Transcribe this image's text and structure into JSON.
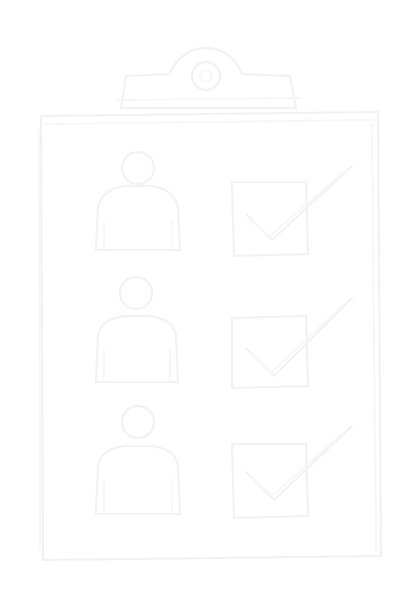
{
  "illustration": {
    "subject": "clipboard-checklist-icon",
    "colors": {
      "background": "#ffffff",
      "stroke": "#f2f2f2",
      "stroke_faint": "#f7f7f7"
    },
    "rows": [
      {
        "person_icon": "person-icon",
        "checkbox_icon": "checked-box-icon",
        "checked": true
      },
      {
        "person_icon": "person-icon",
        "checkbox_icon": "checked-box-icon",
        "checked": true
      },
      {
        "person_icon": "person-icon",
        "checkbox_icon": "checked-box-icon",
        "checked": true
      }
    ]
  }
}
